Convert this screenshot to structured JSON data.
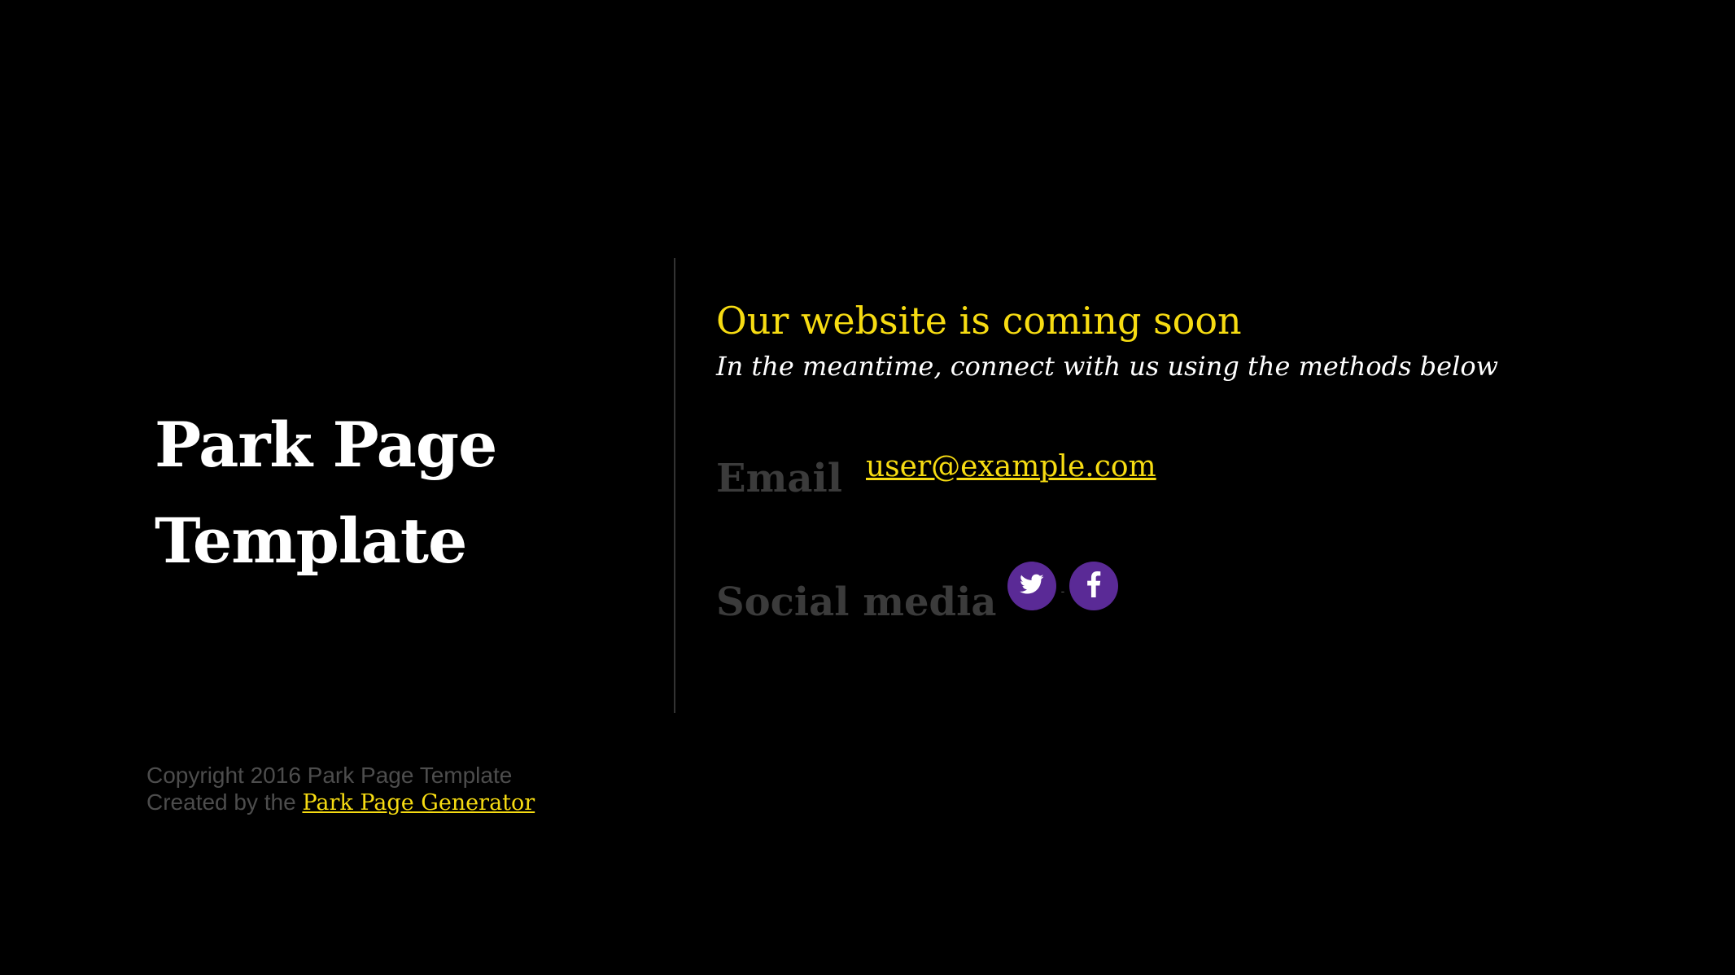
{
  "brand": {
    "title_line1": "Park Page",
    "title_line2": "Template"
  },
  "main": {
    "headline": "Our website is coming soon",
    "subheadline": "In the meantime, connect with us using the methods below"
  },
  "contact": {
    "email_label": "Email",
    "email_value": "user@example.com",
    "social_label": "Social media",
    "social_separator": "-",
    "social_icons": [
      "twitter-icon",
      "facebook-icon"
    ]
  },
  "footer": {
    "copyright": "Copyright 2016 Park Page Template",
    "created_prefix": "Created by the",
    "generator_link": "Park Page Generator"
  },
  "colors": {
    "background": "#000000",
    "accent_yellow": "#f7dc12",
    "title_white": "#ffffff",
    "label_gray": "#3b3b3b",
    "social_purple": "#5a2a96",
    "divider": "#333333",
    "footer_gray": "#4d4d4d"
  }
}
